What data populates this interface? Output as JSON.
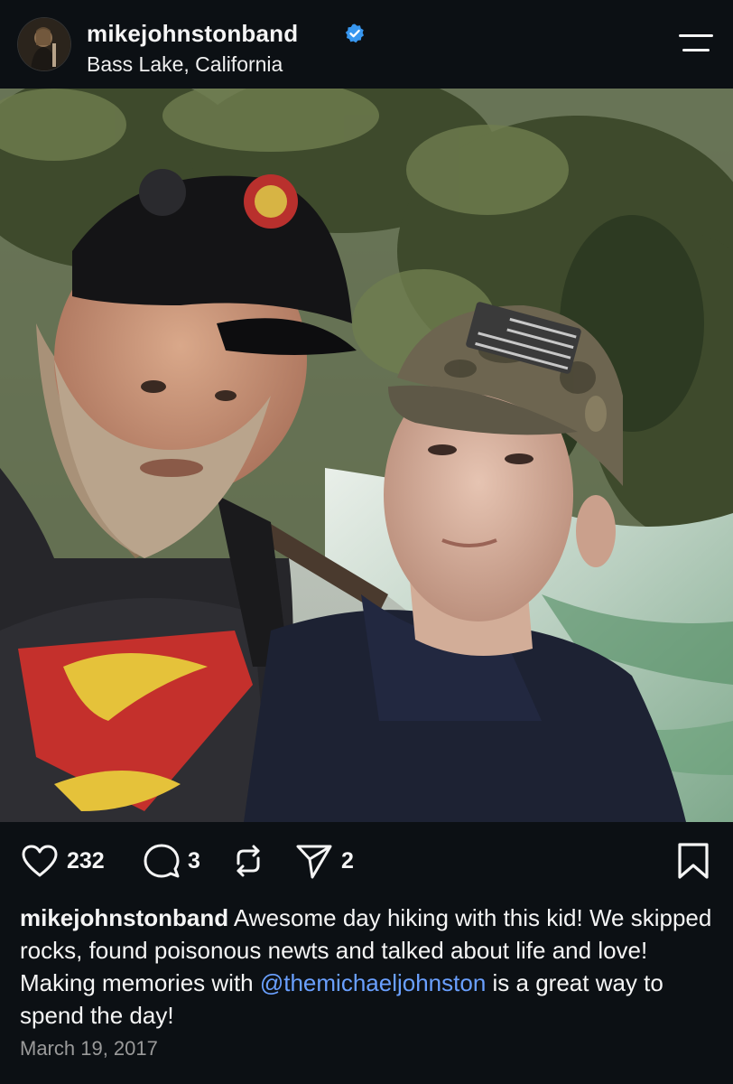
{
  "post": {
    "username": "mikejohnstonband",
    "location": "Bass Lake, California",
    "verified": true,
    "icons": {
      "avatar": "profile-avatar",
      "verified": "verified-badge-icon",
      "menu": "menu-icon"
    }
  },
  "actions": {
    "likes": "232",
    "comments": "3",
    "shares": "2",
    "icons": [
      "heart-icon",
      "comment-icon",
      "repost-icon",
      "share-icon",
      "bookmark-icon"
    ]
  },
  "caption": {
    "author": "mikejohnstonband",
    "text_before_mention": " Awesome day hiking with this kid! We skipped rocks, found poisonous newts and talked about life and love! Making memories with ",
    "mention": "@themichaeljohnston",
    "text_after_mention": " is a great way to spend the day!"
  },
  "date": "March 19, 2017",
  "colors": {
    "background": "#0c1014",
    "text": "#f5f5f5",
    "mention": "#6aa0ff",
    "verified": "#3897f0",
    "muted": "#9a9a9a"
  }
}
